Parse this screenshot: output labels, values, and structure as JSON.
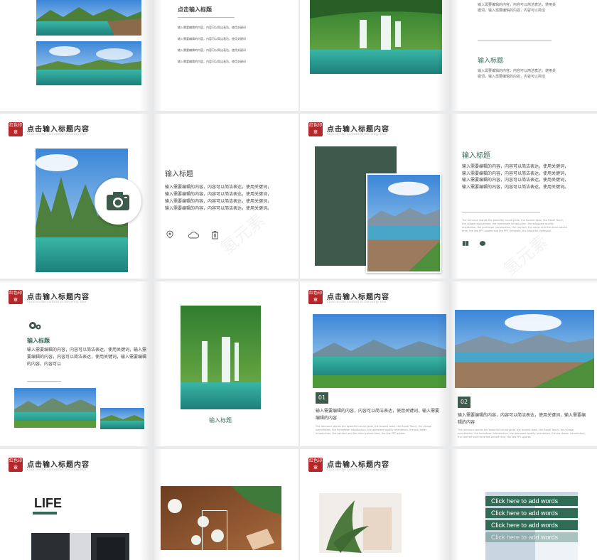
{
  "slide_header": {
    "title": "点击输入标题内容",
    "subtitle": "Click on the content of the entry title",
    "logo_text": "红色印章"
  },
  "row1": {
    "b_title": "点击输入标题",
    "b_lines": [
      "输入需要编辑的内容，内容可以简洁表达，使用关键词",
      "输入需要编辑的内容，内容可以简洁表达，使用关键词",
      "输入需要编辑的内容，内容可以简洁表达，使用关键词",
      "输入需要编辑的内容，内容可以简洁表达，使用关键词"
    ],
    "d_top_text": "输入需要编辑的内容，内容可以简洁表达，使用关键词，输入需要编辑的内容，内容可以简洁",
    "d_heading": "输入标题",
    "d_body": "输入需要编辑的内容，内容可以简洁表达，使用关键词，输入需要编辑的内容，内容可以简洁"
  },
  "row2": {
    "b_heading": "输入标题",
    "b_body": "输入需要编辑的内容，内容可以简洁表达，使用关键词，输入需要编辑的内容，内容可以简洁表达，使用关键词，输入需要编辑的内容，内容可以简洁表达，使用关键词，输入需要编辑的内容，内容可以简洁表达，使用关键词。",
    "d_heading": "输入标题",
    "d_body": "输入需要编辑的内容，内容可以简洁表达，使用关键词，输入需要编辑的内容，内容可以简洁表达，使用关键词，输入需要编辑的内容，内容可以简洁表达，使用关键词，输入需要编辑的内容，内容可以简洁表达，使用关键词。",
    "d_small": "The romance stands the beautiful countryside, the busiest town, the Baudi Touch, the village mainstream, the hometown introduction, the adequate quality orientation, the purchaser introduction, the comfort, the lesser and the dried valued time, the low PPT quotes and the PPT Template, the beautiful nightspot",
    "watermark": "氢元素"
  },
  "row3": {
    "a_heading": "输入标题",
    "a_body": "输入需要编辑的内容，内容可以简洁表达，使用关键词，输入需要编辑的内容，内容可以简洁表达，使用关键词，输入需要编辑的内容，内容可以",
    "b_caption": "输入标题",
    "c_num": "01",
    "c_body": "输入需要编辑的内容，内容可以简洁表达，使用关键词，输入需要编辑的内容",
    "c_small": "The romance stands the beautiful countryside, the busiest town, the Baudi Touch, the village mainstream, the hometown introduction, the adequate quality orientation, the purchaser introduction, the comfort and the dried valued time, the low PPT quotes",
    "d_num": "02",
    "d_body": "输入需要编辑的内容，内容可以简洁表达，使用关键词，输入需要编辑的内容",
    "d_small": "The romance stands the beautiful countryside, the busiest town, the Baudi Touch, the village mainstream, the hometown introduction, the adequate quality orientation, the purchaser introduction, the comfort and the dried valued time, the low PPT quotes"
  },
  "row4": {
    "a_heading": "LIFE",
    "d_words": [
      "Click here to add words",
      "Click here to add words",
      "Click here to add words",
      "Click here to add words"
    ]
  },
  "colors": {
    "accent_green": "#3d5a4c",
    "logo_red": "#b4282b"
  }
}
